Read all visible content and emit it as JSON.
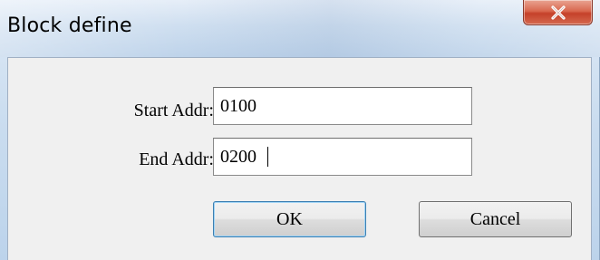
{
  "window": {
    "title": "Block define",
    "close_symbol": "X"
  },
  "form": {
    "start_label": "Start Addr:",
    "start_value": "0100",
    "end_label": "End Addr:",
    "end_value": "0200"
  },
  "buttons": {
    "ok_label": "OK",
    "cancel_label": "Cancel"
  },
  "colors": {
    "close_button": "#c5412a",
    "titlebar": "#cfdff0",
    "client_bg": "#f0f0f0"
  },
  "icons": {
    "close": "close-icon"
  }
}
